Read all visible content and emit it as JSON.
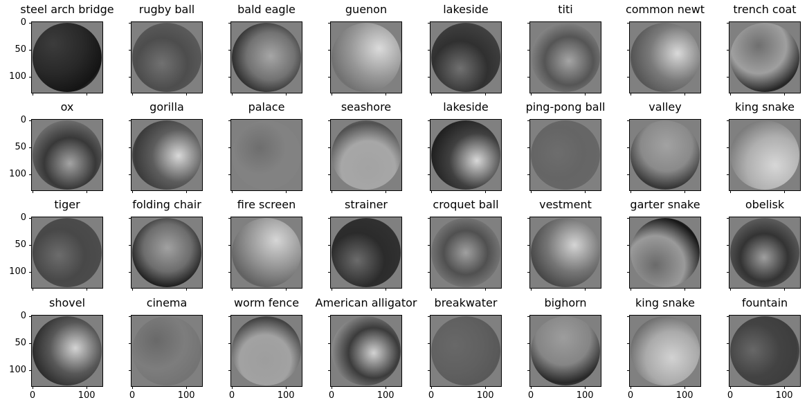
{
  "panels": [
    [
      "steel arch bridge",
      "rugby ball",
      "bald eagle",
      "guenon",
      "lakeside",
      "titi",
      "common newt",
      "trench coat"
    ],
    [
      "ox",
      "gorilla",
      "palace",
      "seashore",
      "lakeside",
      "ping-pong ball",
      "valley",
      "king snake"
    ],
    [
      "tiger",
      "folding chair",
      "fire screen",
      "strainer",
      "croquet ball",
      "vestment",
      "garter snake",
      "obelisk"
    ],
    [
      "shovel",
      "cinema",
      "worm fence",
      "American alligator",
      "breakwater",
      "bighorn",
      "king snake",
      "fountain"
    ]
  ],
  "y_ticks": [
    "0",
    "50",
    "100"
  ],
  "x_ticks": [
    "0",
    "100"
  ],
  "colors": {
    "background": "#808080",
    "axis": "#000000"
  }
}
